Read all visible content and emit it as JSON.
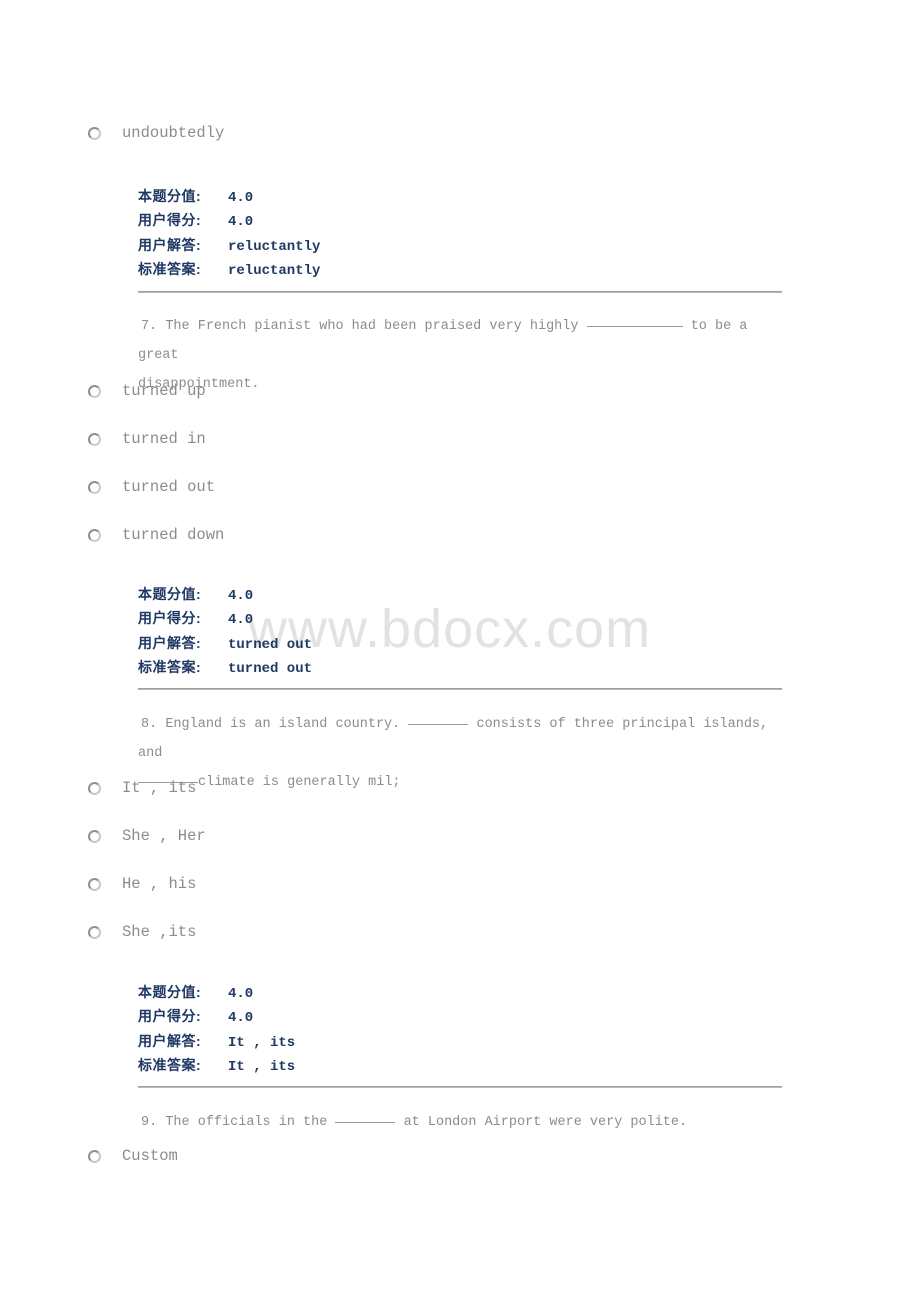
{
  "watermark": {
    "text": "www.bdocx.com"
  },
  "answer_labels": {
    "score": "本题分值:",
    "user_score": "用户得分:",
    "user_answer": "用户解答:",
    "standard_answer": "标准答案:"
  },
  "questions": [
    {
      "id": "q6",
      "trailing_option": "undoubtedly",
      "answers": {
        "score": "4.0",
        "user_score": "4.0",
        "user_answer": "reluctantly",
        "standard_answer": "reluctantly"
      }
    },
    {
      "id": "q7",
      "number": "7.",
      "stem_part1": "The French pianist who had been praised very highly",
      "stem_part2": "to be a great",
      "stem_line2": "disappointment.",
      "options": [
        "turned up",
        "turned in",
        "turned out",
        "turned down"
      ],
      "answers": {
        "score": "4.0",
        "user_score": "4.0",
        "user_answer": "turned out",
        "standard_answer": "turned out"
      }
    },
    {
      "id": "q8",
      "number": "8.",
      "stem_part1": "England is an island country.",
      "stem_part2": "consists of three principal islands, and",
      "stem_line2": "climate is generally mil;",
      "options": [
        "It , its",
        "She , Her",
        "He , his",
        "She ,its"
      ],
      "answers": {
        "score": "4.0",
        "user_score": "4.0",
        "user_answer": "It , its",
        "standard_answer": "It , its"
      }
    },
    {
      "id": "q9",
      "number": "9.",
      "stem_part1": "The officials in the",
      "stem_part2": "at London Airport were very polite.",
      "options": [
        "Custom"
      ]
    }
  ]
}
